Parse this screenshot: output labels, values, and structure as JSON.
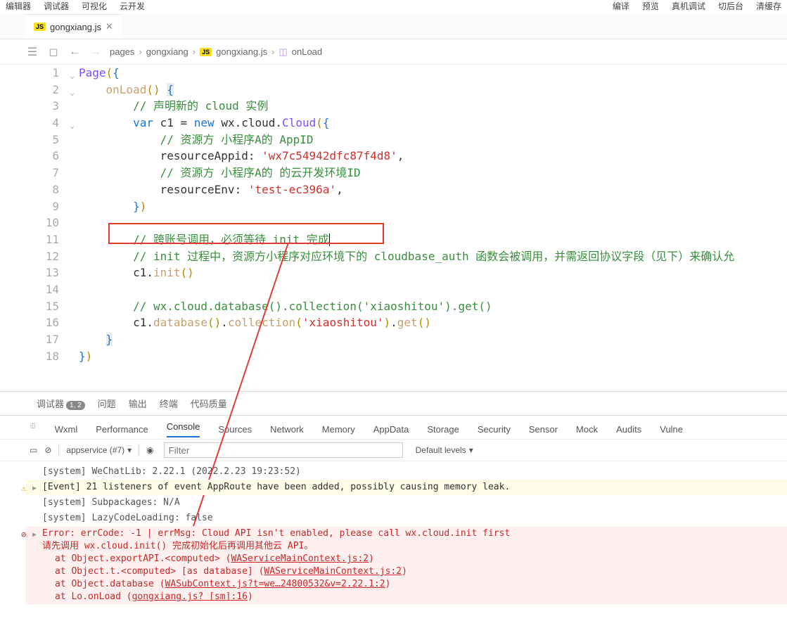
{
  "top_menu": {
    "left": [
      "编辑器",
      "调试器",
      "可视化",
      "云开发"
    ],
    "right": [
      "编译",
      "预览",
      "真机调试",
      "切后台",
      "清缓存"
    ]
  },
  "tab": {
    "filename": "gongxiang.js"
  },
  "breadcrumb": {
    "items": [
      "pages",
      "gongxiang",
      "gongxiang.js",
      "onLoad"
    ]
  },
  "code": {
    "lines": [
      {
        "n": 1,
        "indent": 0,
        "seg": [
          {
            "t": "Page",
            "c": "tok-call"
          },
          {
            "t": "(",
            "c": "tok-brace"
          },
          {
            "t": "{",
            "c": "tok-brace-blue"
          }
        ]
      },
      {
        "n": 2,
        "indent": 1,
        "seg": [
          {
            "t": "onLoad",
            "c": "tok-fn"
          },
          {
            "t": "()",
            "c": "tok-brace"
          },
          {
            "t": " "
          },
          {
            "t": "{",
            "c": "tok-brace-blue bracket-hl"
          }
        ]
      },
      {
        "n": 3,
        "indent": 2,
        "seg": [
          {
            "t": "// 声明新的 cloud 实例",
            "c": "tok-cmt"
          }
        ]
      },
      {
        "n": 4,
        "indent": 2,
        "seg": [
          {
            "t": "var",
            "c": "tok-kw"
          },
          {
            "t": " c1 "
          },
          {
            "t": "=",
            "c": "tok-op"
          },
          {
            "t": " "
          },
          {
            "t": "new",
            "c": "tok-kw"
          },
          {
            "t": " wx"
          },
          {
            "t": ".",
            "c": "tok-op"
          },
          {
            "t": "cloud",
            "c": "tok-prop"
          },
          {
            "t": ".",
            "c": "tok-op"
          },
          {
            "t": "Cloud",
            "c": "tok-call"
          },
          {
            "t": "(",
            "c": "tok-brace"
          },
          {
            "t": "{",
            "c": "tok-brace-blue"
          }
        ]
      },
      {
        "n": 5,
        "indent": 3,
        "seg": [
          {
            "t": "// 资源方 小程序A的 AppID",
            "c": "tok-cmt"
          }
        ]
      },
      {
        "n": 6,
        "indent": 3,
        "seg": [
          {
            "t": "resourceAppid"
          },
          {
            "t": ": "
          },
          {
            "t": "'wx7c54942dfc87f4d8'",
            "c": "tok-str"
          },
          {
            "t": ","
          }
        ]
      },
      {
        "n": 7,
        "indent": 3,
        "seg": [
          {
            "t": "// 资源方 小程序A的 的云开发环境ID",
            "c": "tok-cmt"
          }
        ]
      },
      {
        "n": 8,
        "indent": 3,
        "seg": [
          {
            "t": "resourceEnv"
          },
          {
            "t": ": "
          },
          {
            "t": "'test-ec396a'",
            "c": "tok-str"
          },
          {
            "t": ","
          }
        ]
      },
      {
        "n": 9,
        "indent": 2,
        "seg": [
          {
            "t": "}",
            "c": "tok-brace-blue"
          },
          {
            "t": ")",
            "c": "tok-brace"
          }
        ]
      },
      {
        "n": 10,
        "indent": 0,
        "seg": []
      },
      {
        "n": 11,
        "indent": 2,
        "seg": [
          {
            "t": "// 跨账号调用，必须等待 init 完成",
            "c": "tok-cmt"
          }
        ],
        "cursor": true
      },
      {
        "n": 12,
        "indent": 2,
        "seg": [
          {
            "t": "// init 过程中，资源方小程序对应环境下的 cloudbase_auth 函数会被调用，并需返回协议字段（见下）来确认允",
            "c": "tok-cmt"
          }
        ]
      },
      {
        "n": 13,
        "indent": 2,
        "seg": [
          {
            "t": "c1"
          },
          {
            "t": ".",
            "c": "tok-op"
          },
          {
            "t": "init",
            "c": "tok-fn"
          },
          {
            "t": "()",
            "c": "tok-brace"
          }
        ]
      },
      {
        "n": 14,
        "indent": 0,
        "seg": []
      },
      {
        "n": 15,
        "indent": 2,
        "seg": [
          {
            "t": "// wx.cloud.database().collection('xiaoshitou').get()",
            "c": "tok-cmt"
          }
        ]
      },
      {
        "n": 16,
        "indent": 2,
        "seg": [
          {
            "t": "c1"
          },
          {
            "t": ".",
            "c": "tok-op"
          },
          {
            "t": "database",
            "c": "tok-fn"
          },
          {
            "t": "()",
            "c": "tok-brace"
          },
          {
            "t": ".",
            "c": "tok-op"
          },
          {
            "t": "collection",
            "c": "tok-fn"
          },
          {
            "t": "(",
            "c": "tok-brace"
          },
          {
            "t": "'xiaoshitou'",
            "c": "tok-str"
          },
          {
            "t": ")",
            "c": "tok-brace"
          },
          {
            "t": ".",
            "c": "tok-op"
          },
          {
            "t": "get",
            "c": "tok-fn"
          },
          {
            "t": "()",
            "c": "tok-brace"
          }
        ]
      },
      {
        "n": 17,
        "indent": 1,
        "seg": [
          {
            "t": "}",
            "c": "tok-brace-blue bracket-hl"
          }
        ]
      },
      {
        "n": 18,
        "indent": 0,
        "seg": [
          {
            "t": "}",
            "c": "tok-brace-blue"
          },
          {
            "t": ")",
            "c": "tok-brace"
          }
        ]
      }
    ]
  },
  "panel_tabs": {
    "items": [
      "调试器",
      "问题",
      "输出",
      "终端",
      "代码质量"
    ],
    "badge": "1, 2"
  },
  "devtools_tabs": {
    "items": [
      "Wxml",
      "Performance",
      "Console",
      "Sources",
      "Network",
      "Memory",
      "AppData",
      "Storage",
      "Security",
      "Sensor",
      "Mock",
      "Audits",
      "Vulne"
    ],
    "active": 2
  },
  "console_toolbar": {
    "context": "appservice (#7)",
    "filter_placeholder": "Filter",
    "levels": "Default levels"
  },
  "console": {
    "rows": [
      {
        "type": "sys",
        "text": "[system] WeChatLib: 2.22.1 (2022.2.23 19:23:52)"
      },
      {
        "type": "warn",
        "tri": true,
        "text": "[Event] 21 listeners of event AppRoute have been added, possibly causing memory leak."
      },
      {
        "type": "sys",
        "text": "[system] Subpackages: N/A"
      },
      {
        "type": "sys",
        "text": "[system] LazyCodeLoading: false"
      }
    ],
    "error": {
      "head": "Error: errCode: -1  | errMsg: Cloud API isn't enabled, please call wx.cloud.init first",
      "sub": "请先调用 wx.cloud.init() 完成初始化后再调用其他云 API。",
      "stack": [
        {
          "pre": "    at Object.exportAPI.<computed> (",
          "link": "WAServiceMainContext.js:2",
          "post": ")"
        },
        {
          "pre": "    at Object.t.<computed> [as database] (",
          "link": "WAServiceMainContext.js:2",
          "post": ")"
        },
        {
          "pre": "    at Object.database (",
          "link": "WASubContext.js?t=we…24800532&v=2.22.1:2",
          "post": ")"
        },
        {
          "pre": "    at Lo.onLoad (",
          "link": "gongxiang.js? [sm]:16",
          "post": ")"
        }
      ]
    }
  }
}
